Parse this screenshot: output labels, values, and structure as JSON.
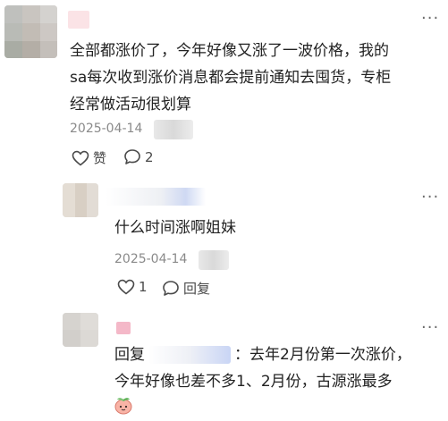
{
  "comments": [
    {
      "text_lines": [
        "全部都涨价了，今年好像又涨了一波价格，我的",
        "sa每次收到涨价消息都会提前通知去囤货，专柜",
        "经常做活动很划算"
      ],
      "date": "2025-04-14",
      "like_label": "赞",
      "comment_count": "2"
    },
    {
      "text": "什么时间涨啊姐妹",
      "date": "2025-04-14",
      "like_count": "1",
      "reply_label": "回复"
    },
    {
      "reply_prefix": "回复",
      "text_line1": "：去年2月份第一次涨价，",
      "text_line2": "今年好像也差不多1、2月份，古源涨最多"
    }
  ],
  "icons": [
    "more-icon",
    "heart-icon",
    "comment-icon",
    "peach-emoji-icon"
  ],
  "colors": {
    "date_gray": "#8a8a8a",
    "text": "#222222",
    "icon_gray": "#4a4a4a",
    "pink_badge": "#f4b8c8"
  }
}
